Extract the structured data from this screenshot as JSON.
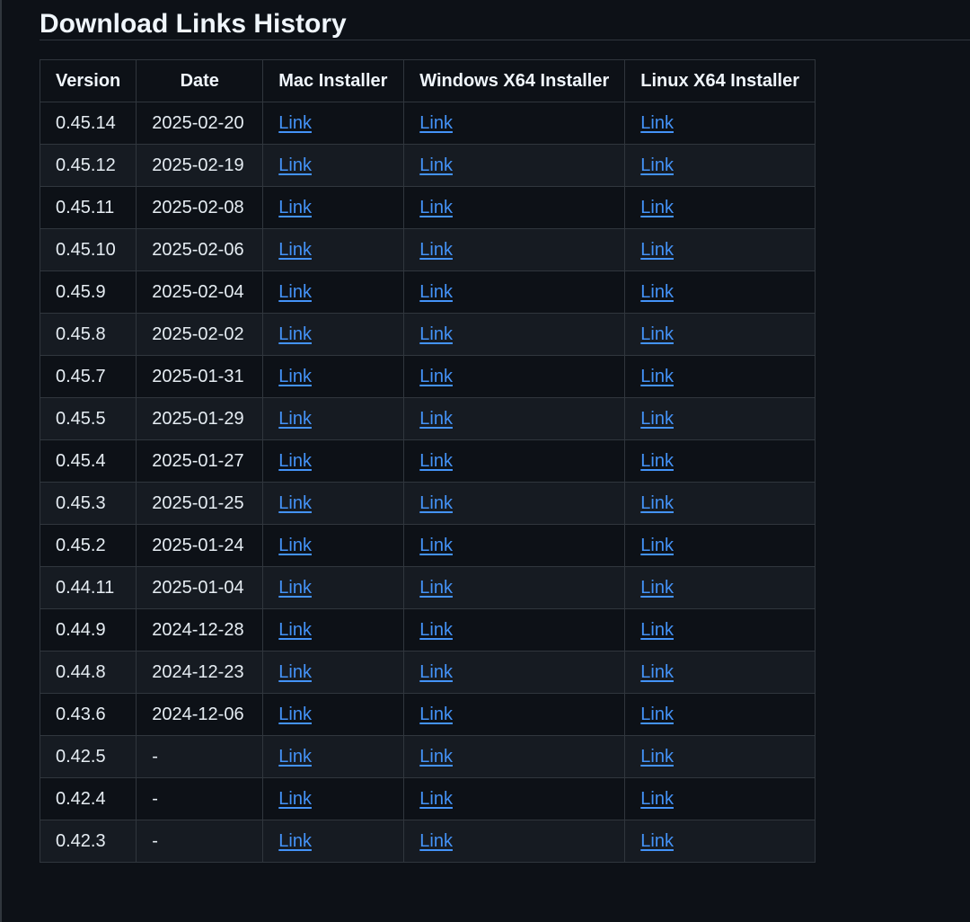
{
  "page": {
    "title": "Download Links History"
  },
  "table": {
    "headers": [
      "Version",
      "Date",
      "Mac Installer",
      "Windows X64 Installer",
      "Linux X64 Installer"
    ],
    "link_label": "Link",
    "rows": [
      {
        "version": "0.45.14",
        "date": "2025-02-20",
        "mac": "Link",
        "windows": "Link",
        "linux": "Link"
      },
      {
        "version": "0.45.12",
        "date": "2025-02-19",
        "mac": "Link",
        "windows": "Link",
        "linux": "Link"
      },
      {
        "version": "0.45.11",
        "date": "2025-02-08",
        "mac": "Link",
        "windows": "Link",
        "linux": "Link"
      },
      {
        "version": "0.45.10",
        "date": "2025-02-06",
        "mac": "Link",
        "windows": "Link",
        "linux": "Link"
      },
      {
        "version": "0.45.9",
        "date": "2025-02-04",
        "mac": "Link",
        "windows": "Link",
        "linux": "Link"
      },
      {
        "version": "0.45.8",
        "date": "2025-02-02",
        "mac": "Link",
        "windows": "Link",
        "linux": "Link"
      },
      {
        "version": "0.45.7",
        "date": "2025-01-31",
        "mac": "Link",
        "windows": "Link",
        "linux": "Link"
      },
      {
        "version": "0.45.5",
        "date": "2025-01-29",
        "mac": "Link",
        "windows": "Link",
        "linux": "Link"
      },
      {
        "version": "0.45.4",
        "date": "2025-01-27",
        "mac": "Link",
        "windows": "Link",
        "linux": "Link"
      },
      {
        "version": "0.45.3",
        "date": "2025-01-25",
        "mac": "Link",
        "windows": "Link",
        "linux": "Link"
      },
      {
        "version": "0.45.2",
        "date": "2025-01-24",
        "mac": "Link",
        "windows": "Link",
        "linux": "Link"
      },
      {
        "version": "0.44.11",
        "date": "2025-01-04",
        "mac": "Link",
        "windows": "Link",
        "linux": "Link"
      },
      {
        "version": "0.44.9",
        "date": "2024-12-28",
        "mac": "Link",
        "windows": "Link",
        "linux": "Link"
      },
      {
        "version": "0.44.8",
        "date": "2024-12-23",
        "mac": "Link",
        "windows": "Link",
        "linux": "Link"
      },
      {
        "version": "0.43.6",
        "date": "2024-12-06",
        "mac": "Link",
        "windows": "Link",
        "linux": "Link"
      },
      {
        "version": "0.42.5",
        "date": "-",
        "mac": "Link",
        "windows": "Link",
        "linux": "Link"
      },
      {
        "version": "0.42.4",
        "date": "-",
        "mac": "Link",
        "windows": "Link",
        "linux": "Link"
      },
      {
        "version": "0.42.3",
        "date": "-",
        "mac": "Link",
        "windows": "Link",
        "linux": "Link"
      }
    ]
  },
  "colors": {
    "background": "#0d1117",
    "row_alt": "#161b22",
    "border": "#30363d",
    "link": "#4493f8",
    "text": "#e6edf3"
  }
}
